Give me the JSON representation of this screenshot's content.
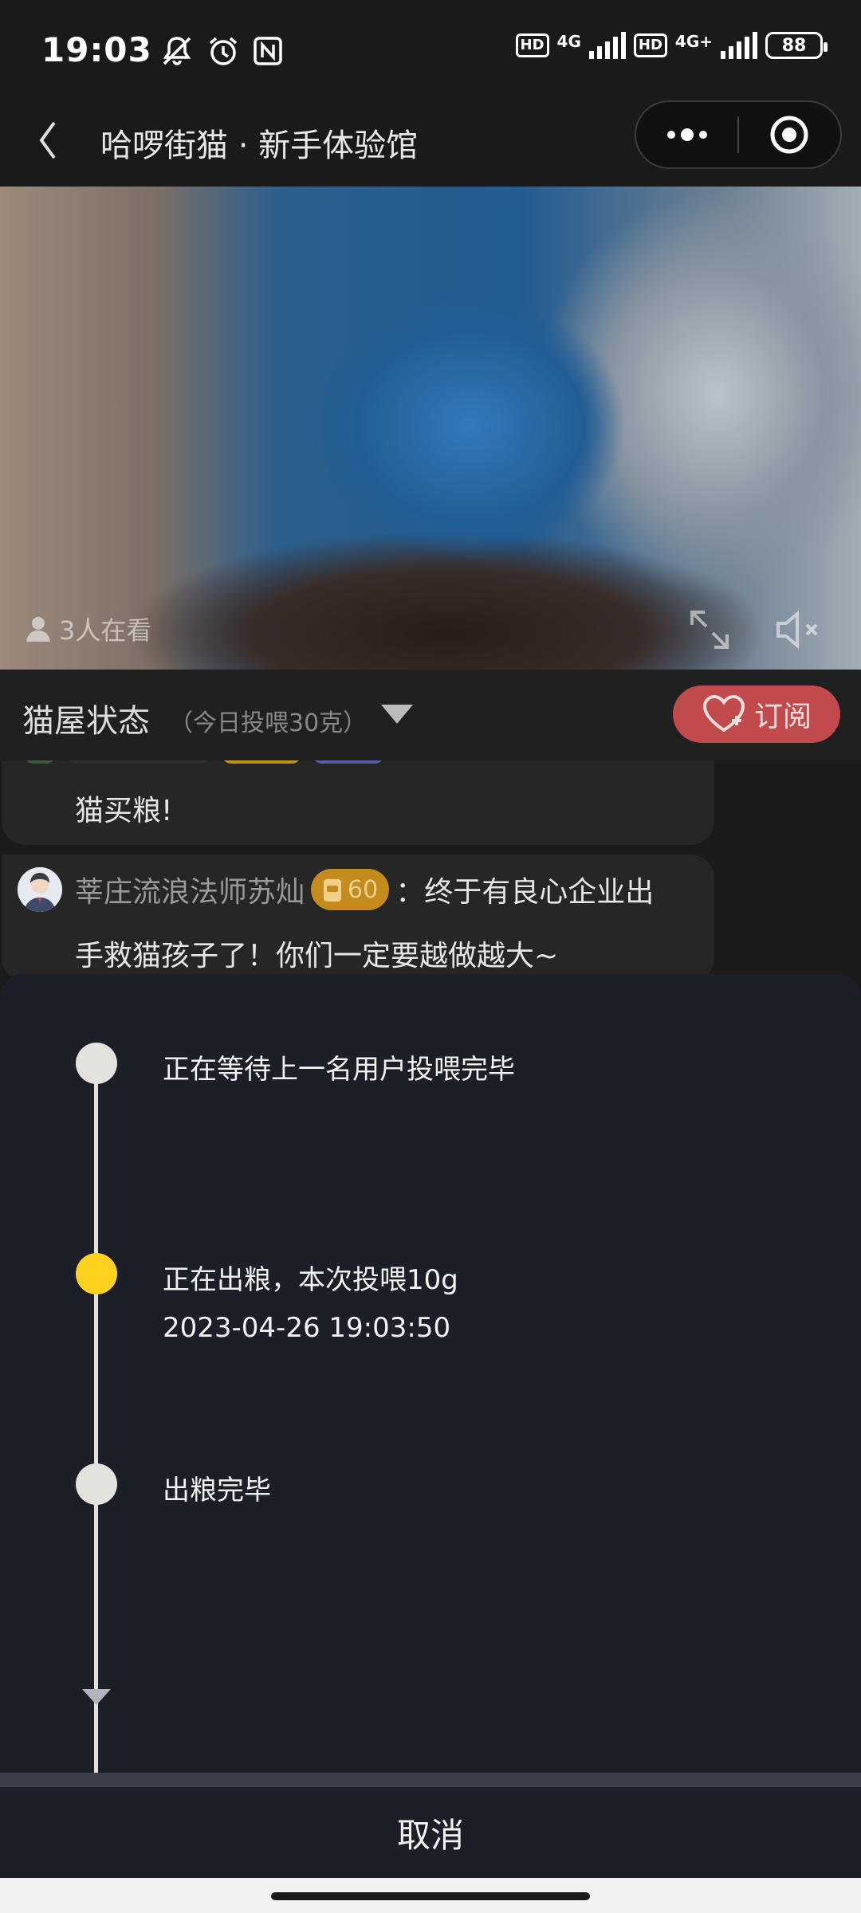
{
  "status_bar": {
    "time": "19:03",
    "icons_left": [
      "mute-icon",
      "alarm-icon",
      "nfc-icon"
    ],
    "hd1": "HD",
    "network1": "4G",
    "hd2": "HD",
    "network2": "4G+",
    "battery": "88"
  },
  "nav": {
    "title": "哈啰街猫 · 新手体验馆",
    "back_icon": "back-arrow-icon",
    "more_icon": "more-dots-icon",
    "close_icon": "target-circle-icon"
  },
  "video": {
    "viewers": "3人在看"
  },
  "cat_house": {
    "title": "猫屋状态",
    "subtitle": "（今日投喂30克）",
    "subscribe_label": "订阅"
  },
  "comments": [
    {
      "text": "猫买粮!"
    },
    {
      "user": "莘庄流浪法师苏灿",
      "level": "60",
      "text_line1": "：终于有良心企业出",
      "text_line2": "手救猫孩子了！你们一定要越做越大~"
    }
  ],
  "feeding": {
    "steps": [
      {
        "text": "正在等待上一名用户投喂完毕",
        "time": "",
        "active": false
      },
      {
        "text": "正在出粮，本次投喂10g",
        "time": "2023-04-26 19:03:50",
        "active": true
      },
      {
        "text": "出粮完毕",
        "time": "",
        "active": false
      }
    ],
    "cancel_label": "取消"
  },
  "colors": {
    "active_dot": "#ffd21f",
    "subscribe_bg": "#c14a4c",
    "level_badge": "#c48c1d",
    "sheet_bg": "#1c1f28"
  }
}
